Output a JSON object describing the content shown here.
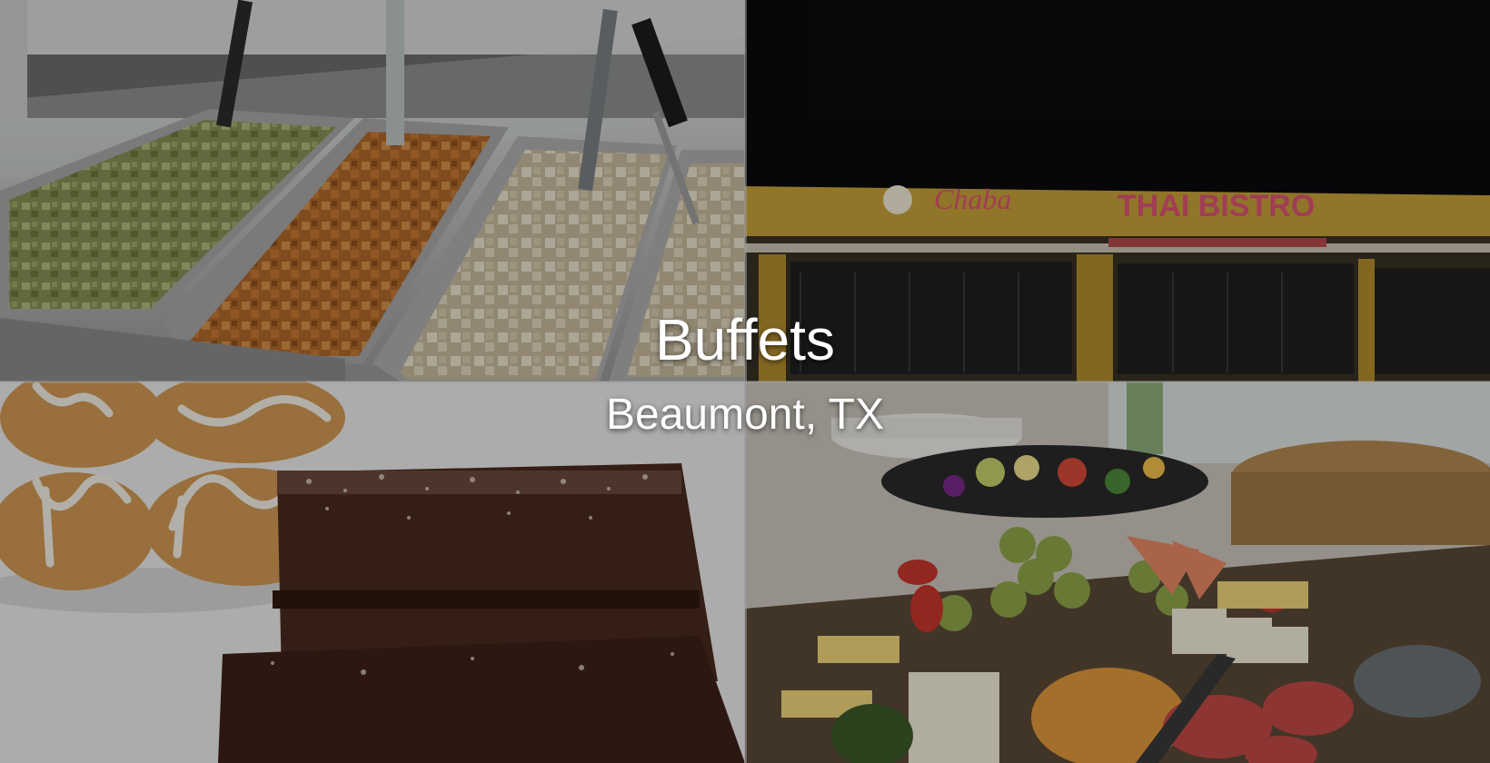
{
  "hero": {
    "title": "Buffets",
    "subtitle": "Beaumont, TX"
  },
  "photos": {
    "top_left": "buffet-trays-photo",
    "top_right": "restaurant-storefront-photo",
    "bottom_left": "brownies-and-rolls-photo",
    "bottom_right": "fruit-and-cheese-platter-photo"
  },
  "storefront_sign": {
    "left": "Chaba",
    "right": "THAI BISTRO"
  },
  "colors": {
    "overlay": "#000000",
    "text": "#ffffff",
    "sign": "#e05575",
    "facade": "#c9a23a"
  }
}
